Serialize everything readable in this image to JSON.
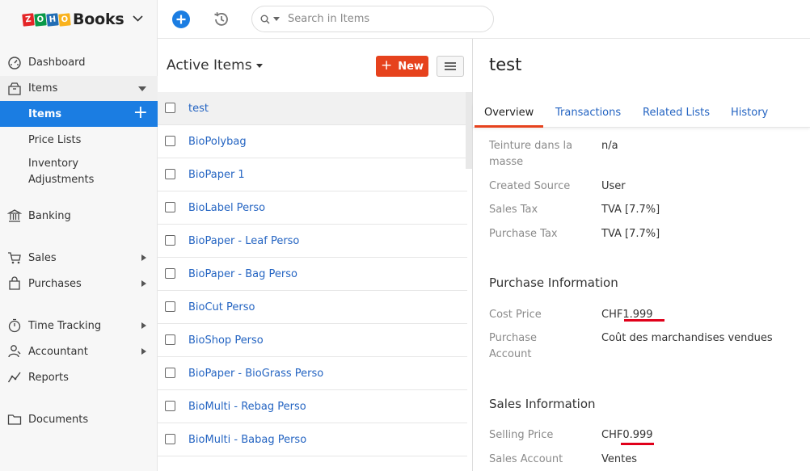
{
  "brand": {
    "name": "Books",
    "zoho_letters": [
      "Z",
      "O",
      "H",
      "O"
    ],
    "zoho_colors": [
      "#e42527",
      "#089949",
      "#226db4",
      "#f9b21d"
    ]
  },
  "search": {
    "placeholder": "Search in Items"
  },
  "sidebar": {
    "items": [
      {
        "label": "Dashboard",
        "icon": "dashboard-icon"
      },
      {
        "label": "Items",
        "icon": "items-icon"
      },
      {
        "label": "Items"
      },
      {
        "label": "Price Lists"
      },
      {
        "label": "Inventory"
      },
      {
        "label": "Adjustments"
      },
      {
        "label": "Banking",
        "icon": "bank-icon"
      },
      {
        "label": "Sales",
        "icon": "cart-icon"
      },
      {
        "label": "Purchases",
        "icon": "bag-icon"
      },
      {
        "label": "Time Tracking",
        "icon": "timer-icon"
      },
      {
        "label": "Accountant",
        "icon": "accountant-icon"
      },
      {
        "label": "Reports",
        "icon": "reports-icon"
      },
      {
        "label": "Documents",
        "icon": "folder-icon"
      }
    ]
  },
  "list": {
    "title": "Active Items",
    "new_label": "New",
    "rows": [
      {
        "name": "test"
      },
      {
        "name": "BioPolybag"
      },
      {
        "name": "BioPaper 1"
      },
      {
        "name": "BioLabel Perso"
      },
      {
        "name": "BioPaper - Leaf Perso"
      },
      {
        "name": "BioPaper - Bag Perso"
      },
      {
        "name": "BioCut Perso"
      },
      {
        "name": "BioShop Perso"
      },
      {
        "name": "BioPaper - BioGrass Perso"
      },
      {
        "name": "BioMulti - Rebag Perso"
      },
      {
        "name": "BioMulti - Babag Perso"
      }
    ]
  },
  "detail": {
    "title": "test",
    "tabs": [
      "Overview",
      "Transactions",
      "Related Lists",
      "History"
    ],
    "fields": [
      {
        "label_1": "Teinture dans la",
        "label_2": "masse",
        "value": "n/a"
      },
      {
        "label": "Created Source",
        "value": "User"
      },
      {
        "label": "Sales Tax",
        "value": "TVA [7.7%]"
      },
      {
        "label": "Purchase Tax",
        "value": "TVA [7.7%]"
      }
    ],
    "purchase": {
      "heading": "Purchase Information",
      "cost_label": "Cost Price",
      "cost_value": "CHF1.999",
      "account_label_1": "Purchase",
      "account_label_2": "Account",
      "account_value": "Coût des marchandises vendues"
    },
    "sales": {
      "heading": "Sales Information",
      "price_label": "Selling Price",
      "price_value": "CHF0.999",
      "account_label": "Sales Account",
      "account_value": "Ventes"
    }
  },
  "colors": {
    "accent_blue": "#1b7de2",
    "new_button": "#e6421d",
    "link": "#2464c2",
    "annotation_red": "#e0001a"
  }
}
